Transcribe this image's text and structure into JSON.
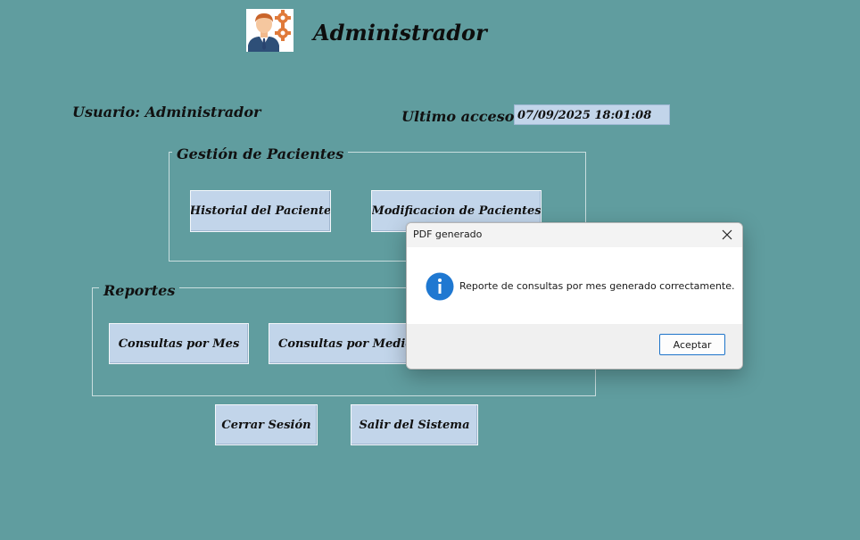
{
  "header": {
    "title": "Administrador",
    "avatar_icon": "admin-user-gears-icon"
  },
  "session": {
    "user_label": "Usuario: Administrador",
    "last_access_label": "Ultimo acceso:",
    "last_access_value": "07/09/2025 18:01:08"
  },
  "groups": {
    "pacientes": {
      "title": "Gestión de Pacientes",
      "buttons": {
        "historial": "Historial del Paciente",
        "modificacion": "Modificacion de Pacientes"
      }
    },
    "reportes": {
      "title": "Reportes",
      "buttons": {
        "consultas_mes": "Consultas por Mes",
        "consultas_medico": "Consultas por Medico"
      }
    }
  },
  "actions": {
    "cerrar_sesion": "Cerrar Sesión",
    "salir": "Salir del Sistema"
  },
  "dialog": {
    "title": "PDF generado",
    "message": "Reporte de consultas por mes generado correctamente.",
    "icon": "info-icon",
    "close_icon": "close-icon",
    "ok_label": "Aceptar"
  },
  "colors": {
    "background": "#609d9f",
    "button": "#c2d5ea",
    "info_blue": "#1f78d1",
    "dialog_accent": "#1e74c9"
  }
}
